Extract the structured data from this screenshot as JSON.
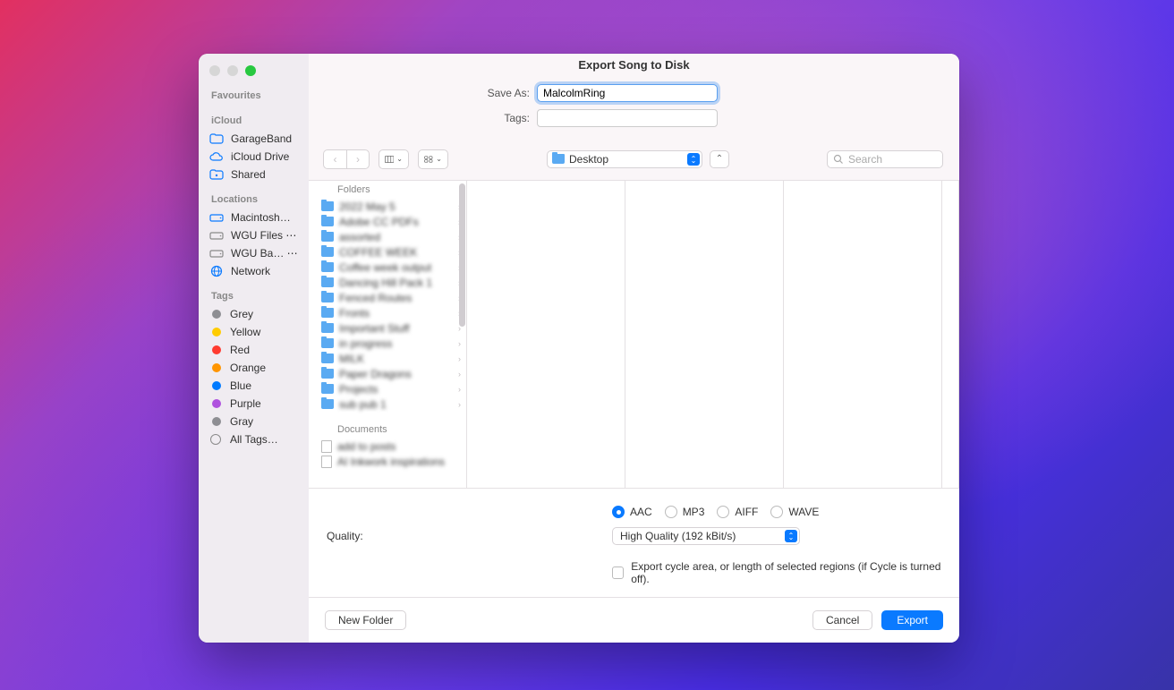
{
  "window": {
    "title": "Export Song to Disk"
  },
  "form": {
    "save_as_label": "Save As:",
    "save_as_value": "MalcolmRing",
    "tags_label": "Tags:",
    "tags_value": ""
  },
  "sidebar": {
    "sections": [
      {
        "header": "Favourites",
        "items": []
      },
      {
        "header": "iCloud",
        "items": [
          {
            "label": "GarageBand",
            "icon": "folder"
          },
          {
            "label": "iCloud Drive",
            "icon": "cloud"
          },
          {
            "label": "Shared",
            "icon": "shared"
          }
        ]
      },
      {
        "header": "Locations",
        "items": [
          {
            "label": "Macintosh…",
            "icon": "disk"
          },
          {
            "label": "WGU Files ⋯",
            "icon": "disk-muted"
          },
          {
            "label": "WGU Ba… ⋯",
            "icon": "disk-muted"
          },
          {
            "label": "Network",
            "icon": "globe"
          }
        ]
      },
      {
        "header": "Tags",
        "items": [
          {
            "label": "Grey",
            "dot": "#8e8e93"
          },
          {
            "label": "Yellow",
            "dot": "#ffcc00"
          },
          {
            "label": "Red",
            "dot": "#ff3b30"
          },
          {
            "label": "Orange",
            "dot": "#ff9500"
          },
          {
            "label": "Blue",
            "dot": "#007aff"
          },
          {
            "label": "Purple",
            "dot": "#af52de"
          },
          {
            "label": "Gray",
            "dot": "#8e8e93"
          },
          {
            "label": "All Tags…",
            "alltags": true
          }
        ]
      }
    ]
  },
  "toolbar": {
    "location": "Desktop",
    "search_placeholder": "Search",
    "collapse_glyph": "⌃"
  },
  "browser": {
    "col_header": "Folders",
    "folders": [
      "2022 May 5",
      "Adobe CC PDFs",
      "assorted",
      "COFFEE WEEK",
      "Coffee week output",
      "Dancing Hill Pack 1",
      "Fenced Routes",
      "Fronts",
      "Important Stuff",
      "in progress",
      "MILK",
      "Paper Dragons",
      "Projects",
      "sub pub 1"
    ],
    "documents_header": "Documents",
    "documents": [
      "add to posts",
      "AI Inkwork inspirations"
    ]
  },
  "export": {
    "formats": [
      {
        "label": "AAC",
        "on": true
      },
      {
        "label": "MP3",
        "on": false
      },
      {
        "label": "AIFF",
        "on": false
      },
      {
        "label": "WAVE",
        "on": false
      }
    ],
    "quality_label": "Quality:",
    "quality_value": "High Quality (192 kBit/s)",
    "cycle_label": "Export cycle area, or length of selected regions (if Cycle is turned off)."
  },
  "footer": {
    "new_folder": "New Folder",
    "cancel": "Cancel",
    "export": "Export"
  }
}
